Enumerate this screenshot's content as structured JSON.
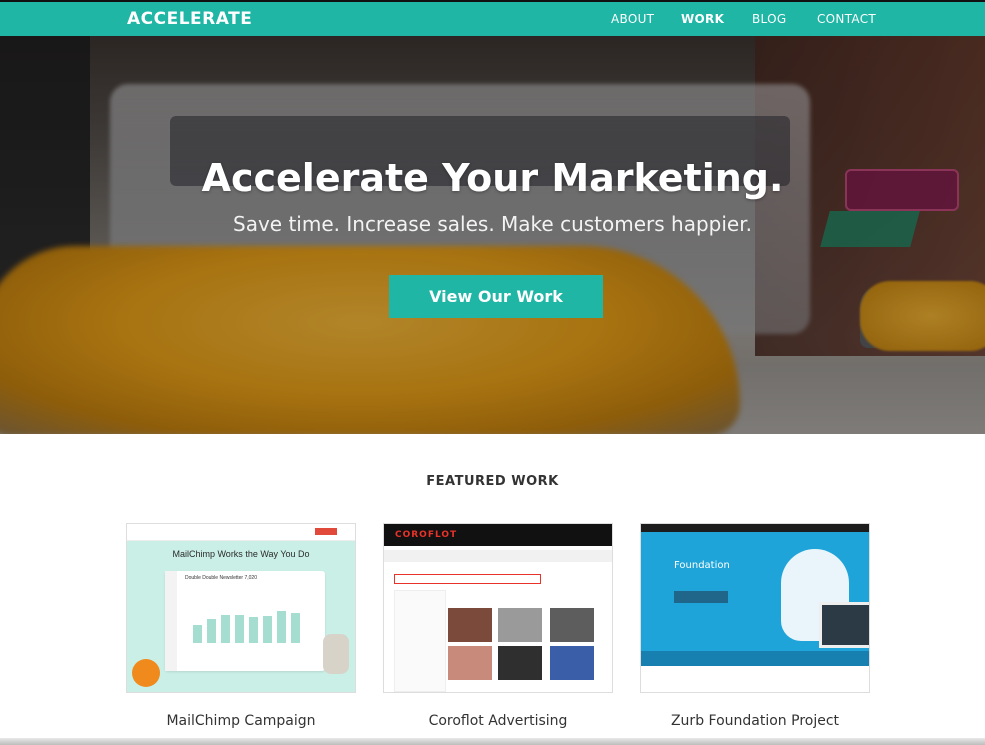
{
  "nav": {
    "brand": "ACCELERATE",
    "links": [
      "ABOUT",
      "WORK",
      "BLOG",
      "CONTACT"
    ],
    "active": "WORK",
    "bg_color": "#1fb6a6"
  },
  "hero": {
    "title": "Accelerate Your Marketing.",
    "subtitle": "Save time. Increase sales. Make customers happier.",
    "button_label": "View Our Work"
  },
  "featured": {
    "heading": "FEATURED WORK",
    "items": [
      {
        "label": "MailChimp Campaign",
        "thumb_heading": "MailChimp Works the Way You Do",
        "thumb_stat": "Double Double Newsletter 7,020"
      },
      {
        "label": "Coroflot Advertising",
        "thumb_logo": "COROFLOT"
      },
      {
        "label": "Zurb Foundation Project",
        "thumb_title": "Foundation"
      }
    ]
  },
  "accent_color": "#1fb6a6"
}
